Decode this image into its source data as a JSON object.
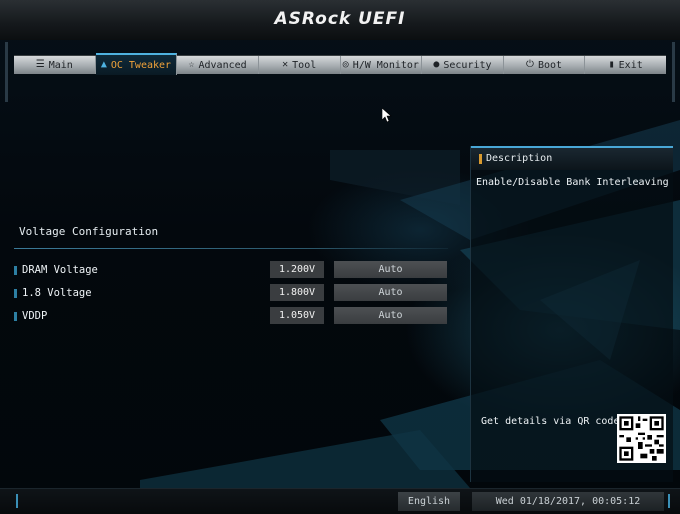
{
  "header": {
    "logo": "ASRock UEFI"
  },
  "tabs": [
    {
      "label": "Main",
      "icon": "list-icon",
      "active": false
    },
    {
      "label": "OC Tweaker",
      "icon": "flame-icon",
      "active": true
    },
    {
      "label": "Advanced",
      "icon": "star-icon",
      "active": false
    },
    {
      "label": "Tool",
      "icon": "tools-icon",
      "active": false
    },
    {
      "label": "H/W Monitor",
      "icon": "monitor-icon",
      "active": false
    },
    {
      "label": "Security",
      "icon": "shield-icon",
      "active": false
    },
    {
      "label": "Boot",
      "icon": "power-icon",
      "active": false
    },
    {
      "label": "Exit",
      "icon": "exit-icon",
      "active": false
    }
  ],
  "section": {
    "title": "Voltage Configuration"
  },
  "settings": [
    {
      "label": "DRAM Voltage",
      "current": "1.200V",
      "value": "Auto"
    },
    {
      "label": "1.8 Voltage",
      "current": "1.800V",
      "value": "Auto"
    },
    {
      "label": "VDDP",
      "current": "1.050V",
      "value": "Auto"
    }
  ],
  "description": {
    "title": "Description",
    "text": "Enable/Disable Bank Interleaving",
    "qr_label": "Get details via QR code"
  },
  "footer": {
    "language": "English",
    "datetime": "Wed 01/18/2017, 00:05:12"
  },
  "colors": {
    "accent": "#4fb2e0",
    "active_tab_text": "#f0a23a",
    "background": "#02070b"
  }
}
